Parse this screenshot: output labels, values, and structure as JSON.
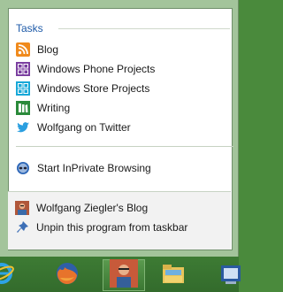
{
  "jumplist": {
    "header": "Tasks",
    "tasks": [
      {
        "label": "Blog",
        "icon": "rss-icon"
      },
      {
        "label": "Windows Phone Projects",
        "icon": "windows-phone-icon"
      },
      {
        "label": "Windows Store Projects",
        "icon": "windows-store-icon"
      },
      {
        "label": "Writing",
        "icon": "writing-icon"
      },
      {
        "label": "Wolfgang on Twitter",
        "icon": "twitter-icon"
      }
    ],
    "inprivate": {
      "label": "Start InPrivate Browsing",
      "icon": "inprivate-icon"
    },
    "bottom": [
      {
        "label": "Wolfgang Ziegler's Blog",
        "icon": "avatar-icon"
      },
      {
        "label": "Unpin this program from taskbar",
        "icon": "unpin-icon"
      }
    ]
  },
  "taskbar": {
    "buttons": [
      "internet-explorer-icon",
      "firefox-icon",
      "pinned-site-icon",
      "file-explorer-icon",
      "app-icon"
    ]
  },
  "colors": {
    "header": "#1e5aa8",
    "frame": "#a3c49b",
    "taskbar": "#3d7b34"
  }
}
